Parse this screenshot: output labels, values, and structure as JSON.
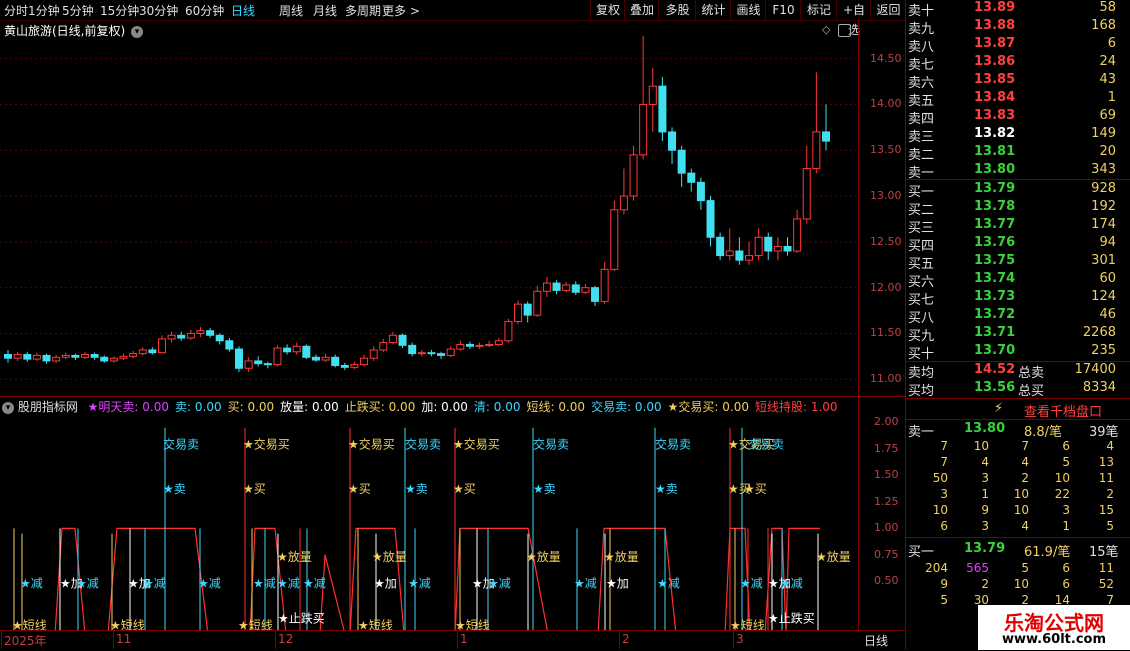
{
  "toolbar": {
    "left_items": [
      "分时",
      "1分钟",
      "5分钟",
      "15分钟",
      "30分钟",
      "60分钟",
      "日线",
      "周线",
      "月线",
      "多周期",
      "更多 >"
    ],
    "active_item": "日线",
    "right_items": [
      "复权",
      "叠加",
      "多股",
      "统计",
      "画线",
      "F10",
      "标记",
      "+自选",
      "返回"
    ]
  },
  "chart_title": "黄山旅游(日线,前复权)",
  "price_axis": {
    "ticks": [
      "14.50",
      "14.00",
      "13.50",
      "13.00",
      "12.50",
      "12.00",
      "11.50",
      "11.00"
    ]
  },
  "indicator": {
    "name": "股朋指标网",
    "params": [
      {
        "label": "★明天卖: 0.00",
        "color": "#e040ff"
      },
      {
        "label": "卖: 0.00",
        "color": "#3fd7ff"
      },
      {
        "label": "买: 0.00",
        "color": "#f0d060"
      },
      {
        "label": "放量: 0.00",
        "color": "#ffffff"
      },
      {
        "label": "止跌买: 0.00",
        "color": "#f0d060"
      },
      {
        "label": "加: 0.00",
        "color": "#ffffff"
      },
      {
        "label": "清: 0.00",
        "color": "#3fd7ff"
      },
      {
        "label": "短线: 0.00",
        "color": "#f0d060"
      },
      {
        "label": "交易卖: 0.00",
        "color": "#3fd7ff"
      },
      {
        "label": "★交易买: 0.00",
        "color": "#f0d060"
      },
      {
        "label": "短线持股: 1.00",
        "color": "#ff4040"
      }
    ],
    "axis_ticks": [
      "2.00",
      "1.75",
      "1.50",
      "1.25",
      "1.00",
      "0.75",
      "0.50"
    ],
    "signals": {
      "jiaoyimai_sell": "交易卖",
      "jiaoyimai_buy": "★交易买",
      "sell": "★卖",
      "buy": "★买",
      "fangliang": "★放量",
      "jian": "★减",
      "jia": "★加",
      "duanxian": "★短线",
      "zhidie": "★止跌买"
    }
  },
  "date_axis": {
    "labels": [
      "2025年",
      "11",
      "12",
      "1",
      "2",
      "3"
    ],
    "period": "日线"
  },
  "orderbook": {
    "asks": [
      {
        "label": "卖十",
        "price": "13.89",
        "vol": "58"
      },
      {
        "label": "卖九",
        "price": "13.88",
        "vol": "168"
      },
      {
        "label": "卖八",
        "price": "13.87",
        "vol": "6"
      },
      {
        "label": "卖七",
        "price": "13.86",
        "vol": "24"
      },
      {
        "label": "卖六",
        "price": "13.85",
        "vol": "43"
      },
      {
        "label": "卖五",
        "price": "13.84",
        "vol": "1"
      },
      {
        "label": "卖四",
        "price": "13.83",
        "vol": "69"
      },
      {
        "label": "卖三",
        "price": "13.82",
        "vol": "149"
      },
      {
        "label": "卖二",
        "price": "13.81",
        "vol": "20"
      },
      {
        "label": "卖一",
        "price": "13.80",
        "vol": "343"
      }
    ],
    "bids": [
      {
        "label": "买一",
        "price": "13.79",
        "vol": "928"
      },
      {
        "label": "买二",
        "price": "13.78",
        "vol": "192"
      },
      {
        "label": "买三",
        "price": "13.77",
        "vol": "174"
      },
      {
        "label": "买四",
        "price": "13.76",
        "vol": "94"
      },
      {
        "label": "买五",
        "price": "13.75",
        "vol": "301"
      },
      {
        "label": "买六",
        "price": "13.74",
        "vol": "60"
      },
      {
        "label": "买七",
        "price": "13.73",
        "vol": "124"
      },
      {
        "label": "买八",
        "price": "13.72",
        "vol": "46"
      },
      {
        "label": "买九",
        "price": "13.71",
        "vol": "2268"
      },
      {
        "label": "买十",
        "price": "13.70",
        "vol": "235"
      }
    ],
    "avg_sell": {
      "label": "卖均",
      "price": "14.52",
      "total_label": "总卖",
      "total": "17400"
    },
    "avg_buy": {
      "label": "买均",
      "price": "13.56",
      "total_label": "总买",
      "total": "8334"
    },
    "view_button": "查看千档盘口",
    "sell1_summary": {
      "label": "卖一",
      "price": "13.80",
      "avg": "8.8/笔",
      "count": "39笔"
    },
    "sell1_grid": [
      [
        "7",
        "10",
        "7",
        "6",
        "4"
      ],
      [
        "7",
        "4",
        "4",
        "5",
        "13"
      ],
      [
        "50",
        "3",
        "2",
        "10",
        "11"
      ],
      [
        "3",
        "1",
        "10",
        "22",
        "2"
      ],
      [
        "10",
        "9",
        "10",
        "3",
        "15"
      ],
      [
        "6",
        "3",
        "4",
        "1",
        "5"
      ]
    ],
    "buy1_summary": {
      "label": "买一",
      "price": "13.79",
      "avg": "61.9/笔",
      "count": "15笔"
    },
    "buy1_grid": [
      [
        "204",
        "565",
        "5",
        "6",
        "11"
      ],
      [
        "9",
        "2",
        "10",
        "6",
        "52"
      ],
      [
        "5",
        "30",
        "2",
        "14",
        "7"
      ]
    ]
  },
  "watermark": {
    "title": "乐淘公式网",
    "url": "www.60lt.com"
  },
  "chart_data": {
    "type": "candlestick",
    "title": "黄山旅游(日线,前复权)",
    "ylim": [
      10.85,
      14.9
    ],
    "candles": [
      [
        11.27,
        11.23,
        11.32,
        11.18
      ],
      [
        11.23,
        11.27,
        11.3,
        11.2
      ],
      [
        11.27,
        11.22,
        11.3,
        11.19
      ],
      [
        11.22,
        11.26,
        11.29,
        11.2
      ],
      [
        11.26,
        11.2,
        11.28,
        11.17
      ],
      [
        11.2,
        11.24,
        11.27,
        11.18
      ],
      [
        11.24,
        11.26,
        11.29,
        11.22
      ],
      [
        11.26,
        11.24,
        11.28,
        11.21
      ],
      [
        11.24,
        11.27,
        11.3,
        11.22
      ],
      [
        11.27,
        11.24,
        11.29,
        11.21
      ],
      [
        11.24,
        11.2,
        11.26,
        11.18
      ],
      [
        11.2,
        11.23,
        11.25,
        11.18
      ],
      [
        11.23,
        11.25,
        11.28,
        11.21
      ],
      [
        11.25,
        11.28,
        11.31,
        11.23
      ],
      [
        11.28,
        11.32,
        11.35,
        11.26
      ],
      [
        11.32,
        11.29,
        11.35,
        11.27
      ],
      [
        11.29,
        11.44,
        11.48,
        11.28
      ],
      [
        11.44,
        11.48,
        11.52,
        11.4
      ],
      [
        11.48,
        11.45,
        11.52,
        11.42
      ],
      [
        11.45,
        11.5,
        11.54,
        11.43
      ],
      [
        11.5,
        11.53,
        11.57,
        11.46
      ],
      [
        11.53,
        11.48,
        11.56,
        11.45
      ],
      [
        11.48,
        11.42,
        11.5,
        11.38
      ],
      [
        11.42,
        11.33,
        11.45,
        11.3
      ],
      [
        11.33,
        11.12,
        11.36,
        11.08
      ],
      [
        11.12,
        11.2,
        11.24,
        11.08
      ],
      [
        11.2,
        11.17,
        11.25,
        11.14
      ],
      [
        11.17,
        11.16,
        11.19,
        11.12
      ],
      [
        11.16,
        11.34,
        11.37,
        11.14
      ],
      [
        11.34,
        11.3,
        11.38,
        11.27
      ],
      [
        11.3,
        11.36,
        11.4,
        11.27
      ],
      [
        11.36,
        11.24,
        11.38,
        11.22
      ],
      [
        11.24,
        11.21,
        11.27,
        11.19
      ],
      [
        11.21,
        11.24,
        11.28,
        11.19
      ],
      [
        11.24,
        11.15,
        11.27,
        11.13
      ],
      [
        11.15,
        11.13,
        11.18,
        11.1
      ],
      [
        11.13,
        11.16,
        11.19,
        11.11
      ],
      [
        11.16,
        11.23,
        11.27,
        11.14
      ],
      [
        11.23,
        11.32,
        11.36,
        11.2
      ],
      [
        11.32,
        11.4,
        11.44,
        11.3
      ],
      [
        11.4,
        11.48,
        11.52,
        11.38
      ],
      [
        11.48,
        11.37,
        11.5,
        11.34
      ],
      [
        11.37,
        11.28,
        11.4,
        11.25
      ],
      [
        11.28,
        11.29,
        11.32,
        11.25
      ],
      [
        11.29,
        11.28,
        11.32,
        11.25
      ],
      [
        11.28,
        11.26,
        11.3,
        11.22
      ],
      [
        11.26,
        11.33,
        11.36,
        11.24
      ],
      [
        11.33,
        11.38,
        11.42,
        11.31
      ],
      [
        11.38,
        11.36,
        11.41,
        11.33
      ],
      [
        11.36,
        11.37,
        11.4,
        11.33
      ],
      [
        11.37,
        11.38,
        11.42,
        11.35
      ],
      [
        11.38,
        11.42,
        11.45,
        11.36
      ],
      [
        11.42,
        11.63,
        11.66,
        11.4
      ],
      [
        11.63,
        11.82,
        11.86,
        11.6
      ],
      [
        11.82,
        11.7,
        11.85,
        11.62
      ],
      [
        11.7,
        11.96,
        12.02,
        11.68
      ],
      [
        11.96,
        12.05,
        12.12,
        11.9
      ],
      [
        12.05,
        11.97,
        12.08,
        11.93
      ],
      [
        11.97,
        12.03,
        12.06,
        11.95
      ],
      [
        12.03,
        11.95,
        12.07,
        11.92
      ],
      [
        11.95,
        12.0,
        12.04,
        11.93
      ],
      [
        12.0,
        11.85,
        12.02,
        11.8
      ],
      [
        11.85,
        12.2,
        12.28,
        11.82
      ],
      [
        12.2,
        12.85,
        12.95,
        12.18
      ],
      [
        12.85,
        13.0,
        13.3,
        12.8
      ],
      [
        13.0,
        13.45,
        13.55,
        12.95
      ],
      [
        13.45,
        14.0,
        14.75,
        13.4
      ],
      [
        14.0,
        14.2,
        14.4,
        13.7
      ],
      [
        14.2,
        13.7,
        14.3,
        13.6
      ],
      [
        13.7,
        13.5,
        13.75,
        13.35
      ],
      [
        13.5,
        13.25,
        13.55,
        13.1
      ],
      [
        13.25,
        13.15,
        13.3,
        13.05
      ],
      [
        13.15,
        12.95,
        13.2,
        12.85
      ],
      [
        12.95,
        12.55,
        13.0,
        12.45
      ],
      [
        12.55,
        12.35,
        12.6,
        12.3
      ],
      [
        12.35,
        12.4,
        12.65,
        12.3
      ],
      [
        12.4,
        12.3,
        12.55,
        12.25
      ],
      [
        12.3,
        12.35,
        12.5,
        12.25
      ],
      [
        12.35,
        12.55,
        12.65,
        12.3
      ],
      [
        12.55,
        12.4,
        12.6,
        12.3
      ],
      [
        12.4,
        12.45,
        12.55,
        12.3
      ],
      [
        12.45,
        12.4,
        12.55,
        12.35
      ],
      [
        12.4,
        12.75,
        12.85,
        12.38
      ],
      [
        12.75,
        13.3,
        13.55,
        12.7
      ],
      [
        13.3,
        13.7,
        14.35,
        13.25
      ],
      [
        13.7,
        13.6,
        14.0,
        13.5
      ]
    ]
  }
}
